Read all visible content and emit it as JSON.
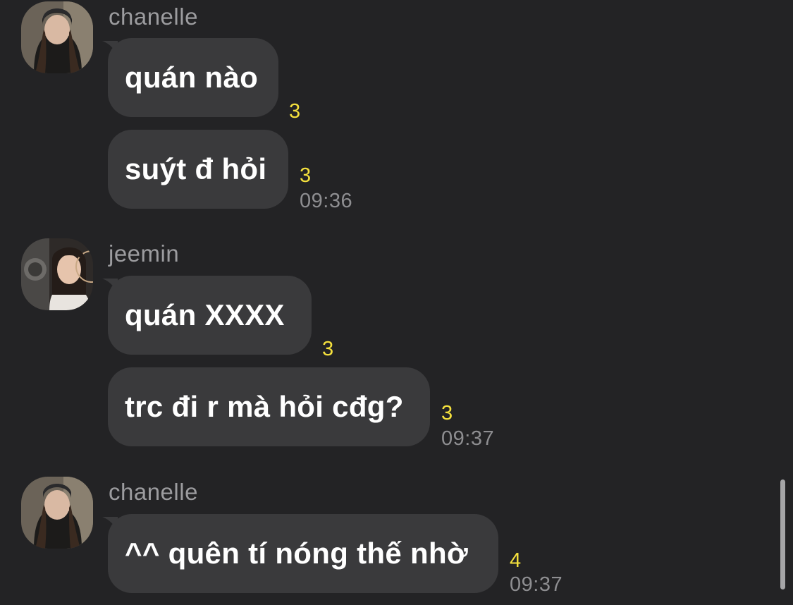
{
  "groups": [
    {
      "sender": "chanelle",
      "avatar_icon": "profile-photo-chanelle",
      "messages": [
        {
          "text": "quán nào",
          "unread": "3"
        },
        {
          "text": "suýt đ hỏi",
          "unread": "3",
          "time": "09:36"
        }
      ]
    },
    {
      "sender": "jeemin",
      "avatar_icon": "profile-photo-jeemin",
      "messages": [
        {
          "text": "quán XXXX",
          "unread": "3"
        },
        {
          "text": "trc đi r mà hỏi cđg?",
          "unread": "3",
          "time": "09:37"
        }
      ]
    },
    {
      "sender": "chanelle",
      "avatar_icon": "profile-photo-chanelle",
      "messages": [
        {
          "text": "^^ quên tí nóng thế nhờ",
          "unread": "4",
          "time": "09:37"
        }
      ]
    }
  ],
  "colors": {
    "background": "#232325",
    "bubble": "#3a3a3c",
    "unread_count": "#f5e13d",
    "timestamp": "#8e8e91",
    "sender_name": "#9c9c9f"
  }
}
